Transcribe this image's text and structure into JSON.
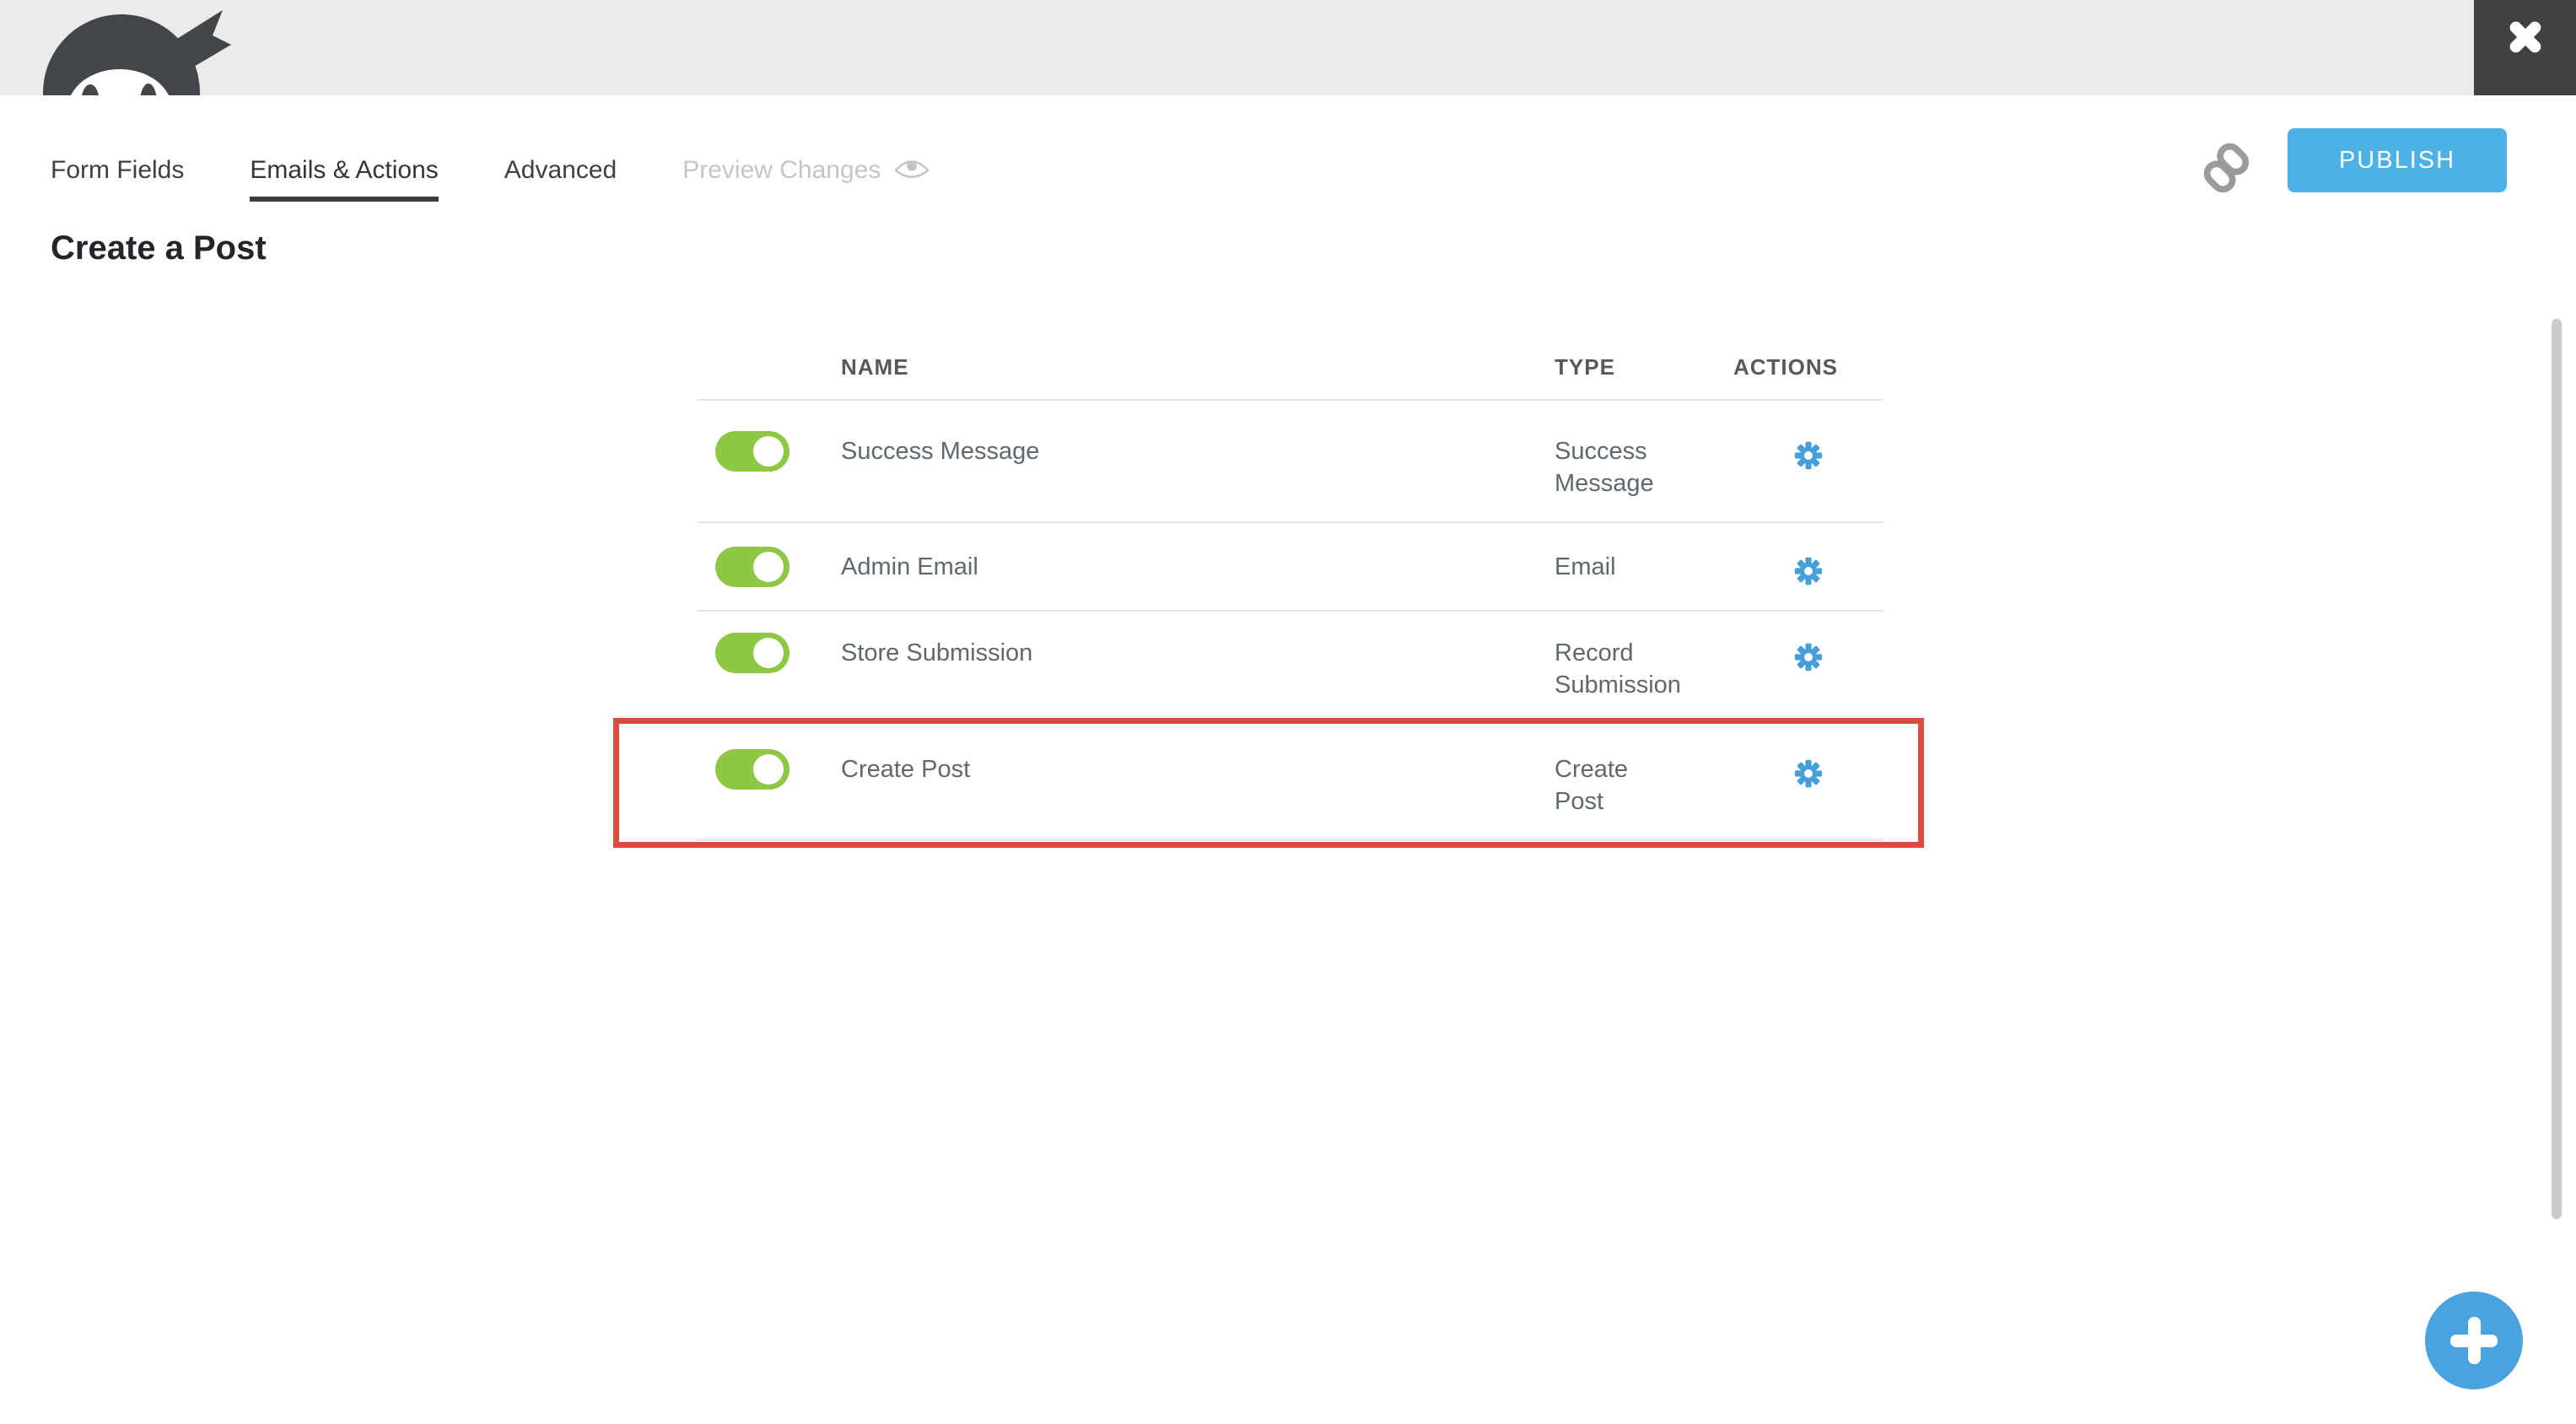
{
  "app": "Ninja Forms form builder",
  "tabs": [
    {
      "label": "Form Fields",
      "active": false
    },
    {
      "label": "Emails & Actions",
      "active": true
    },
    {
      "label": "Advanced",
      "active": false
    },
    {
      "label": "Preview Changes",
      "active": false,
      "disabled": true
    }
  ],
  "toolbar": {
    "publish_label": "PUBLISH"
  },
  "page_title": "Create a Post",
  "table": {
    "headers": {
      "name": "NAME",
      "type": "TYPE",
      "actions": "ACTIONS"
    },
    "rows": [
      {
        "name": "Success Message",
        "type_line1": "Success",
        "type_line2": "Message",
        "enabled": true
      },
      {
        "name": "Admin Email",
        "type_line1": "Email",
        "enabled": true
      },
      {
        "name": "Store Submission",
        "type_line1": "Record",
        "type_line2": "Submission",
        "enabled": true
      },
      {
        "name": "Create Post",
        "type_line1": "Create",
        "type_line2": "Post",
        "enabled": true,
        "highlighted": true
      }
    ]
  },
  "icons": {
    "logo": "ninja-mask-logo",
    "close": "close-icon",
    "preview": "eye-icon",
    "share": "link-icon",
    "row_settings": "gear-icon",
    "add_action": "plus-icon"
  },
  "colors": {
    "header_gray": "#ebebeb",
    "close_dark": "#414141",
    "publish_blue": "#4db1e5",
    "gear_blue": "#469fd8",
    "add_blue": "#4aa3de",
    "toggle_green": "#8dc744",
    "highlight_red": "#dd4a42",
    "row_text": "#5e686d"
  }
}
